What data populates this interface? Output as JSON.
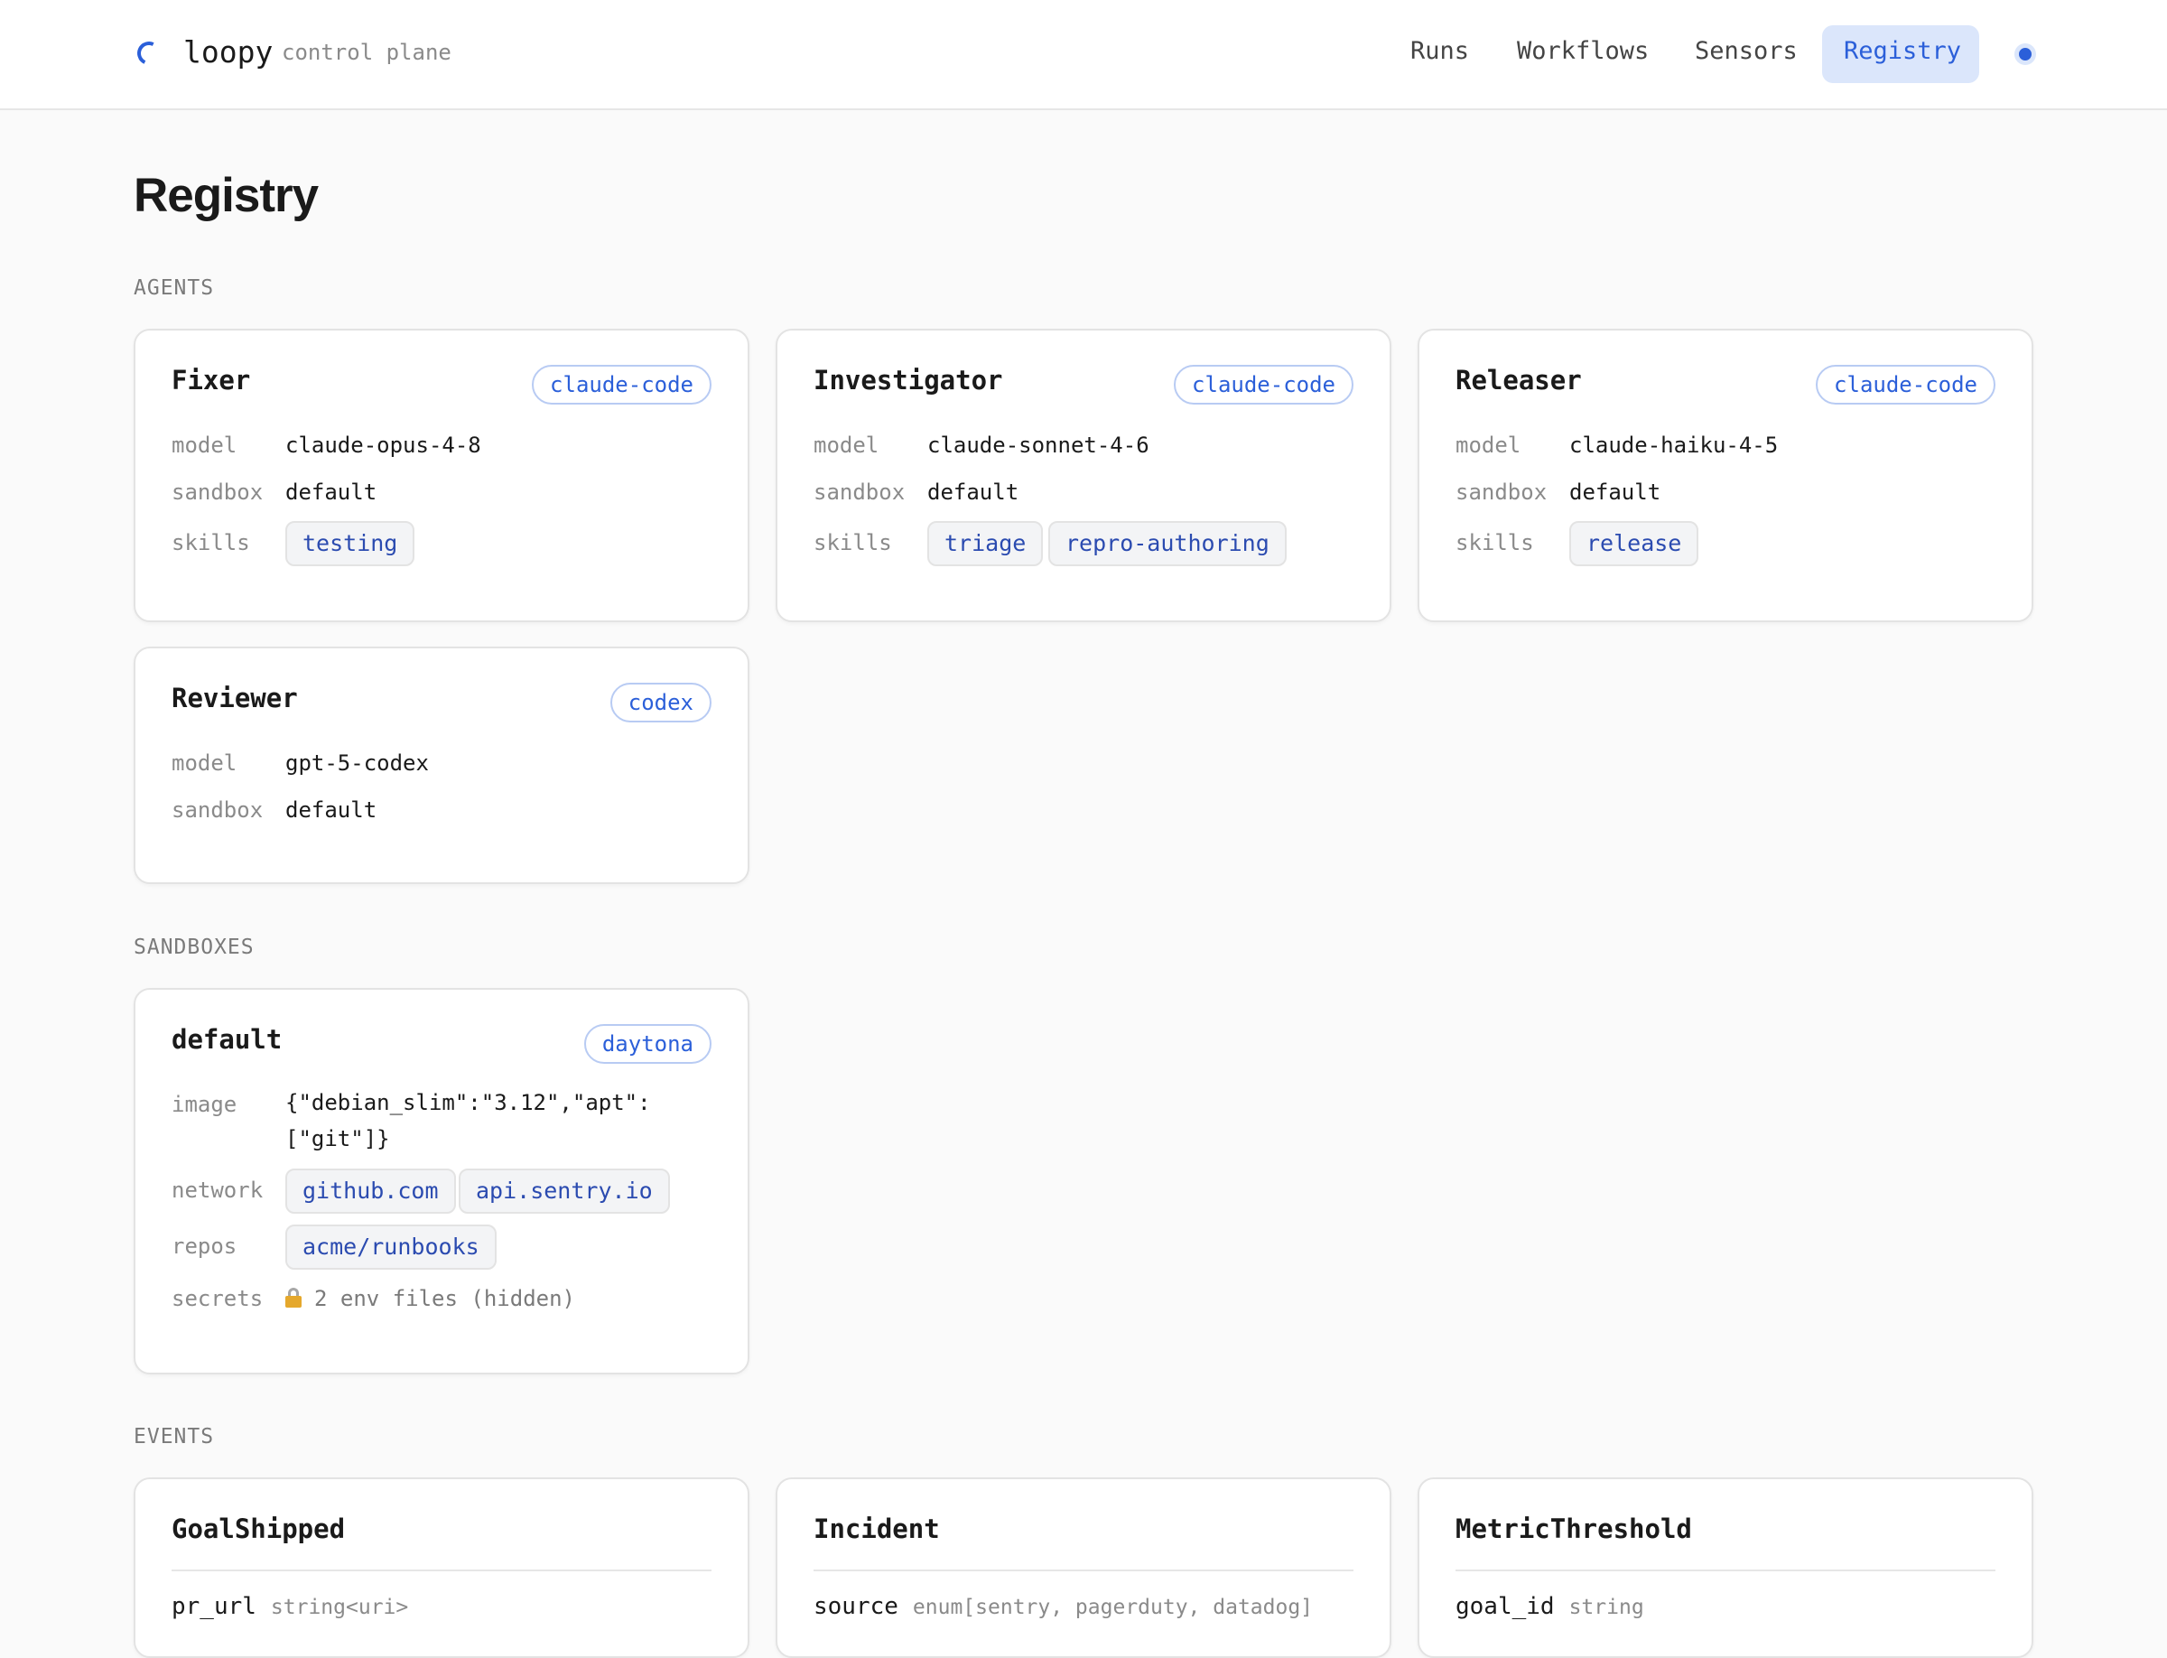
{
  "header": {
    "brand": "loopy",
    "brand_sub": "control plane",
    "nav": [
      {
        "label": "Runs",
        "active": false
      },
      {
        "label": "Workflows",
        "active": false
      },
      {
        "label": "Sensors",
        "active": false
      },
      {
        "label": "Registry",
        "active": true
      }
    ]
  },
  "page": {
    "title": "Registry"
  },
  "agents": {
    "label": "AGENTS",
    "items": [
      {
        "name": "Fixer",
        "runtime": "claude-code",
        "model_key": "model",
        "model": "claude-opus-4-8",
        "sandbox_key": "sandbox",
        "sandbox": "default",
        "skills_key": "skills",
        "skills": [
          "testing"
        ]
      },
      {
        "name": "Investigator",
        "runtime": "claude-code",
        "model_key": "model",
        "model": "claude-sonnet-4-6",
        "sandbox_key": "sandbox",
        "sandbox": "default",
        "skills_key": "skills",
        "skills": [
          "triage",
          "repro-authoring"
        ]
      },
      {
        "name": "Releaser",
        "runtime": "claude-code",
        "model_key": "model",
        "model": "claude-haiku-4-5",
        "sandbox_key": "sandbox",
        "sandbox": "default",
        "skills_key": "skills",
        "skills": [
          "release"
        ]
      },
      {
        "name": "Reviewer",
        "runtime": "codex",
        "model_key": "model",
        "model": "gpt-5-codex",
        "sandbox_key": "sandbox",
        "sandbox": "default"
      }
    ]
  },
  "sandboxes": {
    "label": "SANDBOXES",
    "items": [
      {
        "name": "default",
        "provider": "daytona",
        "image_key": "image",
        "image_line1": "{\"debian_slim\":\"3.12\",\"apt\":",
        "image_line2": "[\"git\"]}",
        "network_key": "network",
        "network": [
          "github.com",
          "api.sentry.io"
        ],
        "repos_key": "repos",
        "repos": [
          "acme/runbooks"
        ],
        "secrets_key": "secrets",
        "secrets": "2 env files (hidden)"
      }
    ]
  },
  "events": {
    "label": "EVENTS",
    "items": [
      {
        "name": "GoalShipped",
        "field": "pr_url",
        "type": "string<uri>"
      },
      {
        "name": "Incident",
        "field": "source",
        "type": "enum[sentry, pagerduty, datadog]"
      },
      {
        "name": "MetricThreshold",
        "field": "goal_id",
        "type": "string"
      }
    ]
  },
  "colors": {
    "accent": "#2b5fd9",
    "accent_bg": "#dbe6fb",
    "card_border": "#e3e3e3",
    "chip_bg": "#f3f4f6"
  }
}
